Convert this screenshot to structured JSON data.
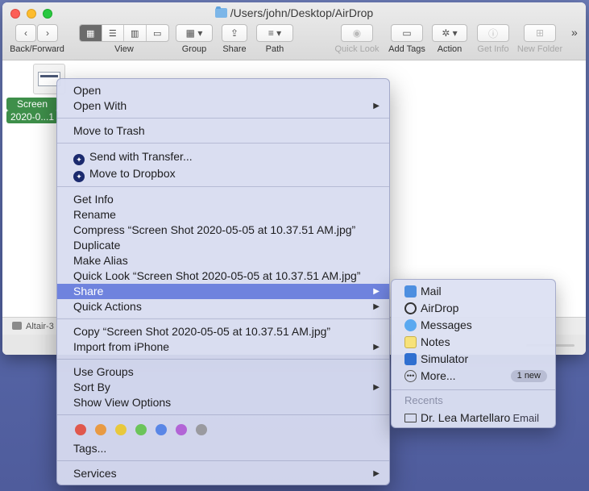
{
  "window": {
    "path": "/Users/john/Desktop/AirDrop"
  },
  "toolbar": {
    "back_forward": "Back/Forward",
    "view": "View",
    "group": "Group",
    "share": "Share",
    "path": "Path",
    "quick_look": "Quick Look",
    "add_tags": "Add Tags",
    "action": "Action",
    "get_info": "Get Info",
    "new_folder": "New Folder",
    "overflow": "»"
  },
  "file": {
    "label_line1": "Screen",
    "label_line2": "2020-0...1"
  },
  "statusbar": {
    "text": "Altair-3"
  },
  "menu": {
    "items": [
      {
        "label": "Open"
      },
      {
        "label": "Open With"
      },
      {
        "label": "Move to Trash"
      },
      {
        "label": "Send with Transfer..."
      },
      {
        "label": "Move to Dropbox"
      },
      {
        "label": "Get Info"
      },
      {
        "label": "Rename"
      },
      {
        "label": "Compress “Screen Shot 2020-05-05 at 10.37.51 AM.jpg”"
      },
      {
        "label": "Duplicate"
      },
      {
        "label": "Make Alias"
      },
      {
        "label": "Quick Look “Screen Shot 2020-05-05 at 10.37.51 AM.jpg”"
      },
      {
        "label": "Share"
      },
      {
        "label": "Quick Actions"
      },
      {
        "label": "Copy “Screen Shot 2020-05-05 at 10.37.51 AM.jpg”"
      },
      {
        "label": "Import from iPhone"
      },
      {
        "label": "Use Groups"
      },
      {
        "label": "Sort By"
      },
      {
        "label": "Show View Options"
      },
      {
        "label": "Tags..."
      },
      {
        "label": "Services"
      }
    ],
    "tag_colors": [
      "#e0584d",
      "#e89a43",
      "#e8c83c",
      "#6cc45a",
      "#5a86e6",
      "#b264d6",
      "#9a9aa0"
    ],
    "highlight_color": "#6f83de"
  },
  "share_submenu": {
    "items": [
      {
        "label": "Mail"
      },
      {
        "label": "AirDrop"
      },
      {
        "label": "Messages"
      },
      {
        "label": "Notes"
      },
      {
        "label": "Simulator"
      },
      {
        "label": "More..."
      }
    ],
    "more_badge": "1 new",
    "recents_label": "Recents",
    "recent_contact": "Dr. Lea Martellaro",
    "recent_contact_kind": "Email"
  }
}
